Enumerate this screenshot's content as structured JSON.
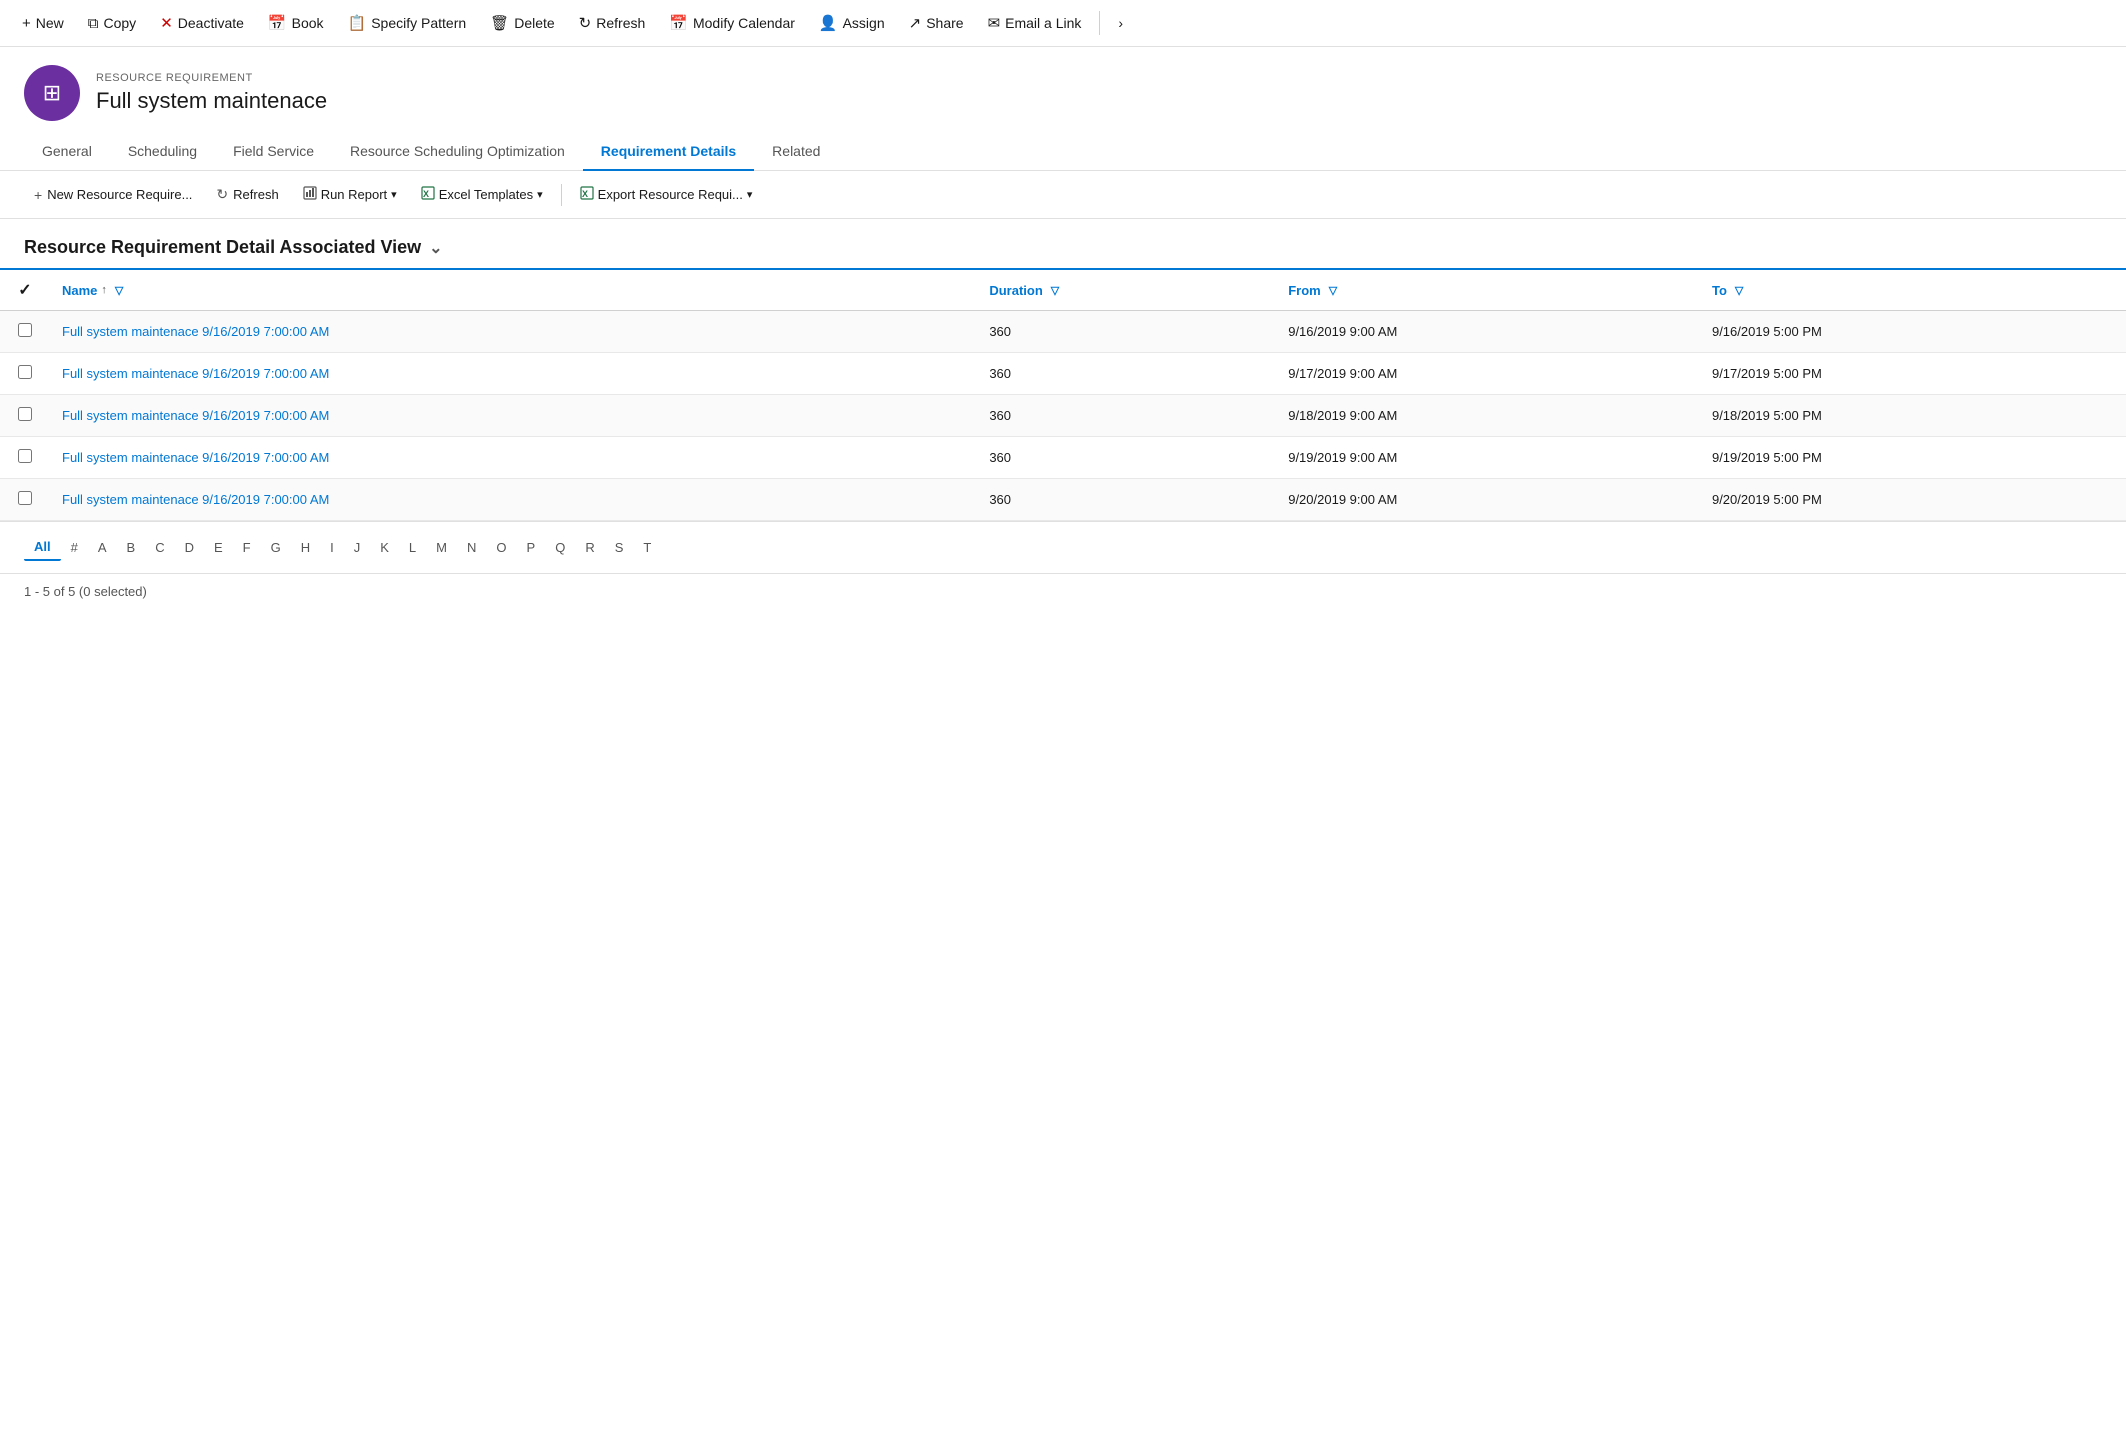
{
  "toolbar": {
    "buttons": [
      {
        "id": "new",
        "label": "New",
        "icon": "+"
      },
      {
        "id": "copy",
        "label": "Copy",
        "icon": "⧉"
      },
      {
        "id": "deactivate",
        "label": "Deactivate",
        "icon": "✕"
      },
      {
        "id": "book",
        "label": "Book",
        "icon": "📅"
      },
      {
        "id": "specify-pattern",
        "label": "Specify Pattern",
        "icon": "📋"
      },
      {
        "id": "delete",
        "label": "Delete",
        "icon": "🗑"
      },
      {
        "id": "refresh",
        "label": "Refresh",
        "icon": "↻"
      },
      {
        "id": "modify-calendar",
        "label": "Modify Calendar",
        "icon": "📅"
      },
      {
        "id": "assign",
        "label": "Assign",
        "icon": "👤"
      },
      {
        "id": "share",
        "label": "Share",
        "icon": "↗"
      },
      {
        "id": "email-a-link",
        "label": "Email a Link",
        "icon": "✉"
      }
    ]
  },
  "record": {
    "type_label": "RESOURCE REQUIREMENT",
    "name": "Full system maintenace",
    "avatar_icon": "⊞"
  },
  "tabs": [
    {
      "id": "general",
      "label": "General",
      "active": false
    },
    {
      "id": "scheduling",
      "label": "Scheduling",
      "active": false
    },
    {
      "id": "field-service",
      "label": "Field Service",
      "active": false
    },
    {
      "id": "resource-scheduling-optimization",
      "label": "Resource Scheduling Optimization",
      "active": false
    },
    {
      "id": "requirement-details",
      "label": "Requirement Details",
      "active": true
    },
    {
      "id": "related",
      "label": "Related",
      "active": false
    }
  ],
  "sub_toolbar": {
    "buttons": [
      {
        "id": "new-resource",
        "label": "New Resource Require...",
        "icon": "+"
      },
      {
        "id": "refresh",
        "label": "Refresh",
        "icon": "↻"
      },
      {
        "id": "run-report",
        "label": "Run Report",
        "icon": "📊",
        "dropdown": true
      },
      {
        "id": "excel-templates",
        "label": "Excel Templates",
        "icon": "📗",
        "dropdown": true
      },
      {
        "id": "export-resource",
        "label": "Export Resource Requi...",
        "icon": "📗",
        "dropdown": true
      }
    ]
  },
  "view": {
    "title": "Resource Requirement Detail Associated View",
    "has_chevron": true
  },
  "table": {
    "columns": [
      {
        "id": "name",
        "label": "Name",
        "sortable": true,
        "filterable": true
      },
      {
        "id": "duration",
        "label": "Duration",
        "filterable": true
      },
      {
        "id": "from",
        "label": "From",
        "filterable": true
      },
      {
        "id": "to",
        "label": "To",
        "filterable": true
      }
    ],
    "rows": [
      {
        "name": "Full system maintenace 9/16/2019 7:00:00 AM",
        "duration": "360",
        "from": "9/16/2019 9:00 AM",
        "to": "9/16/2019 5:00 PM"
      },
      {
        "name": "Full system maintenace 9/16/2019 7:00:00 AM",
        "duration": "360",
        "from": "9/17/2019 9:00 AM",
        "to": "9/17/2019 5:00 PM"
      },
      {
        "name": "Full system maintenace 9/16/2019 7:00:00 AM",
        "duration": "360",
        "from": "9/18/2019 9:00 AM",
        "to": "9/18/2019 5:00 PM"
      },
      {
        "name": "Full system maintenace 9/16/2019 7:00:00 AM",
        "duration": "360",
        "from": "9/19/2019 9:00 AM",
        "to": "9/19/2019 5:00 PM"
      },
      {
        "name": "Full system maintenace 9/16/2019 7:00:00 AM",
        "duration": "360",
        "from": "9/20/2019 9:00 AM",
        "to": "9/20/2019 5:00 PM"
      }
    ]
  },
  "alpha_nav": {
    "items": [
      "All",
      "#",
      "A",
      "B",
      "C",
      "D",
      "E",
      "F",
      "G",
      "H",
      "I",
      "J",
      "K",
      "L",
      "M",
      "N",
      "O",
      "P",
      "Q",
      "R",
      "S",
      "T"
    ],
    "active": "All"
  },
  "footer": {
    "text": "1 - 5 of 5 (0 selected)"
  }
}
